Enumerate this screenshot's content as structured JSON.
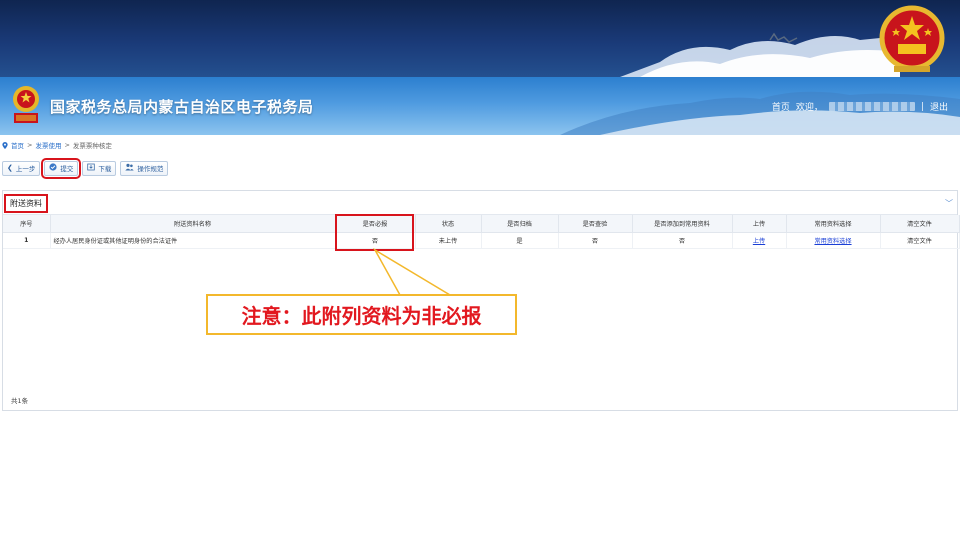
{
  "header": {
    "site_title": "国家税务总局内蒙古自治区电子税务局",
    "links": {
      "home": "首页",
      "welcome": "欢迎，",
      "separator": "|",
      "logout": "退出"
    }
  },
  "breadcrumb": [
    "首页",
    ">",
    "发票使用",
    ">",
    "发票票种核定"
  ],
  "toolbar": {
    "prev": {
      "label": "上一步",
      "icon": "chevron-left-icon"
    },
    "submit": {
      "label": "提交",
      "icon": "check-circle-icon"
    },
    "download": {
      "label": "下载",
      "icon": "download-icon"
    },
    "guide": {
      "label": "操作规范",
      "icon": "users-icon"
    }
  },
  "panel": {
    "title": "附送资料",
    "columns": [
      "序号",
      "附送资料名称",
      "是否必报",
      "状态",
      "是否归档",
      "是否查验",
      "是否添加到常用资料",
      "上传",
      "常用资料选择",
      "清空文件"
    ],
    "rows": [
      [
        "1",
        "经办人居民身份证或其他证明身份的合法证件",
        "否",
        "未上传",
        "是",
        "否",
        "否",
        "上传",
        "常用资料选择",
        "清空文件"
      ]
    ],
    "total": "共1条"
  },
  "callout": {
    "text": "注意：此附列资料为非必报"
  },
  "colors": {
    "highlight": "#d8141c",
    "callout_border": "#f3b82c",
    "callout_text": "#e2181f",
    "link": "#1a3fd6"
  }
}
